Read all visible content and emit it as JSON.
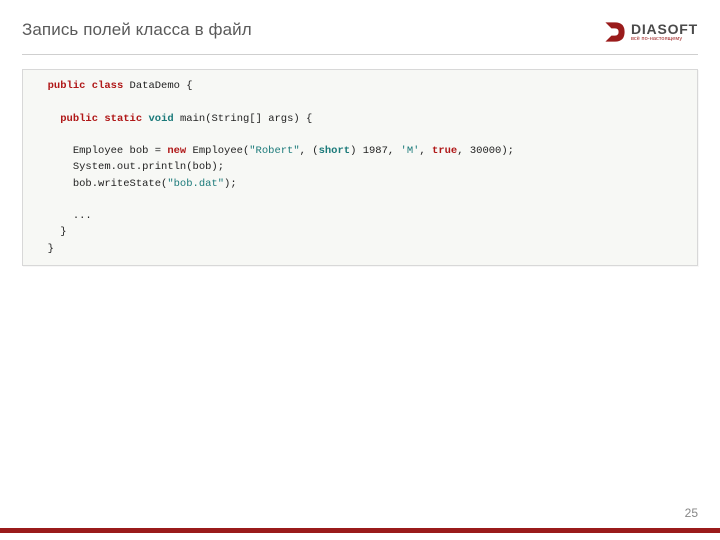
{
  "header": {
    "title": "Запись полей класса в файл",
    "logo_text": "DIASOFT",
    "logo_sub": "всё по-настоящему"
  },
  "code": {
    "l1_kw1": "public",
    "l1_kw2": "class",
    "l1_rest": " DataDemo {",
    "l3_kw1": "public",
    "l3_kw2": "static",
    "l3_kw3": "void",
    "l3_rest": " main(String[] args) {",
    "l5_a": "Employee bob = ",
    "l5_kw": "new",
    "l5_b": " Employee(",
    "l5_str": "\"Robert\"",
    "l5_c": ", (",
    "l5_kw2": "short",
    "l5_d": ") 1987, ",
    "l5_ch": "'M'",
    "l5_e": ", ",
    "l5_kw3": "true",
    "l5_f": ", 30000);",
    "l6": "System.out.println(bob);",
    "l7_a": "bob.writeState(",
    "l7_str": "\"bob.dat\"",
    "l7_b": ");",
    "l9": "...",
    "l10": "}",
    "l11": "}"
  },
  "page_number": "25"
}
